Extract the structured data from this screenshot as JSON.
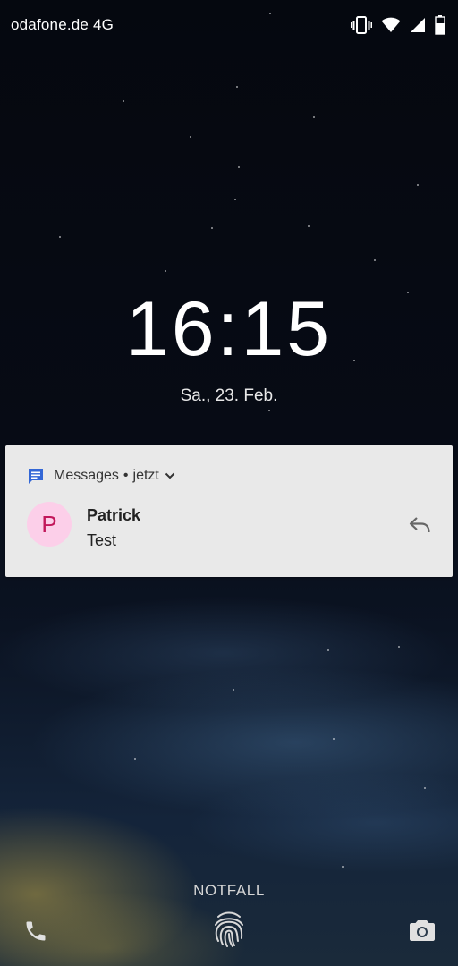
{
  "status_bar": {
    "carrier": "odafone.de 4G",
    "icons": [
      "vibrate-icon",
      "wifi-icon",
      "cell-signal-icon",
      "battery-icon"
    ]
  },
  "lockscreen": {
    "time": "16:15",
    "date": "Sa., 23. Feb."
  },
  "notification": {
    "app_name": "Messages",
    "separator": "•",
    "time": "jetzt",
    "avatar_initial": "P",
    "sender": "Patrick",
    "message": "Test",
    "icons": [
      "messages-app-icon",
      "chevron-down-icon",
      "reply-icon"
    ]
  },
  "bottom_bar": {
    "emergency_label": "NOTFALL",
    "icons": [
      "phone-icon",
      "fingerprint-icon",
      "camera-icon"
    ]
  },
  "colors": {
    "messages_brand": "#3367d6",
    "avatar_bg": "#fccfe9",
    "avatar_text": "#c2185b",
    "card_bg": "#e9e9e9"
  }
}
